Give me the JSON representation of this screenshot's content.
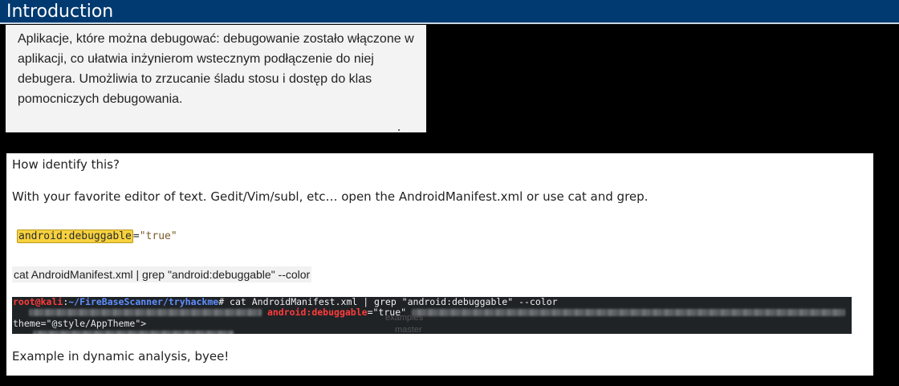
{
  "header": {
    "title": "Introduction"
  },
  "polish_note": {
    "text": "Aplikacje, które można debugować: debugowanie zostało włączone w aplikacji, co ułatwia inżynierom wstecznym podłączenie do niej debugera. Umożliwia to zrzucanie śladu stosu i dostęp do klas pomocniczych debugowania."
  },
  "article": {
    "question": "How identify this?",
    "paragraph1": "With your favorite editor of text. Gedit/Vim/subl, etc… open the AndroidManifest.xml or use cat and grep.",
    "code": {
      "attribute": "android:debuggable",
      "equals": "=",
      "value": "\"true\""
    },
    "command": "cat AndroidManifest.xml | grep \"android:debuggable\" --color",
    "terminal": {
      "prompt_user": "root@kali",
      "prompt_colon": ":",
      "prompt_path": "~/FireBaseScanner/tryhackme",
      "prompt_symbol": "#",
      "command": " cat AndroidManifest.xml | grep \"android:debuggable\" --color",
      "match_attr": "android:debuggable",
      "match_eq": "=",
      "match_value": "\"true\"",
      "theme_line": "theme=\"@style/AppTheme\">",
      "overlay_texts": [
        "examples",
        "master"
      ]
    },
    "paragraph2": "Example in dynamic analysis, byee!"
  }
}
